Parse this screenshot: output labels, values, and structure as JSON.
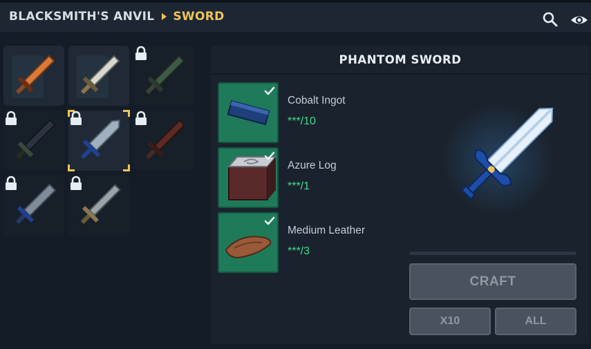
{
  "header": {
    "breadcrumb_root": "BLACKSMITH'S ANVIL",
    "breadcrumb_current": "SWORD",
    "icons": [
      "search-icon",
      "eye-icon"
    ]
  },
  "recipes": [
    {
      "name": "copper-sword",
      "locked": false
    },
    {
      "name": "iron-sword",
      "locked": false
    },
    {
      "name": "jade-sword",
      "locked": true
    },
    {
      "name": "shadow-blade",
      "locked": true
    },
    {
      "name": "phantom-sword",
      "locked": true,
      "selected": true
    },
    {
      "name": "crimson-blade",
      "locked": true
    },
    {
      "name": "sapphire-sword",
      "locked": true
    },
    {
      "name": "bronze-guard-sword",
      "locked": true
    }
  ],
  "detail": {
    "title": "PHANTOM SWORD",
    "ingredients": [
      {
        "name": "Cobalt Ingot",
        "quantity": "***/10",
        "ready": true
      },
      {
        "name": "Azure Log",
        "quantity": "***/1",
        "ready": true
      },
      {
        "name": "Medium Leather",
        "quantity": "***/3",
        "ready": true
      }
    ],
    "craft_label": "CRAFT",
    "x10_label": "X10",
    "all_label": "ALL"
  },
  "colors": {
    "accent_gold": "#f0c35a",
    "ready_green": "#3fdc8c",
    "ingredient_bg": "#1f7a5a"
  }
}
